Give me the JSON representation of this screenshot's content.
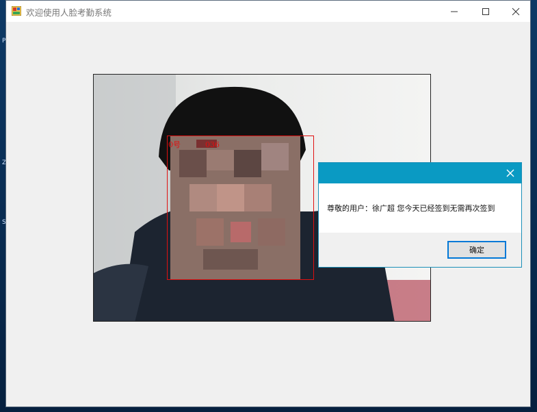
{
  "window": {
    "title": "欢迎使用人脸考勤系统"
  },
  "camera": {
    "face_label_left": "0号",
    "face_label_right": "036"
  },
  "dialog": {
    "message": "尊敬的用户：徐广超 您今天已经签到无需再次签到",
    "ok_label": "确定"
  },
  "desktop": {
    "glyphs": [
      "P",
      "Z",
      "S"
    ]
  },
  "colors": {
    "dialog_header": "#0a9ac3",
    "face_box": "#e01010",
    "ok_border": "#0078d7"
  }
}
